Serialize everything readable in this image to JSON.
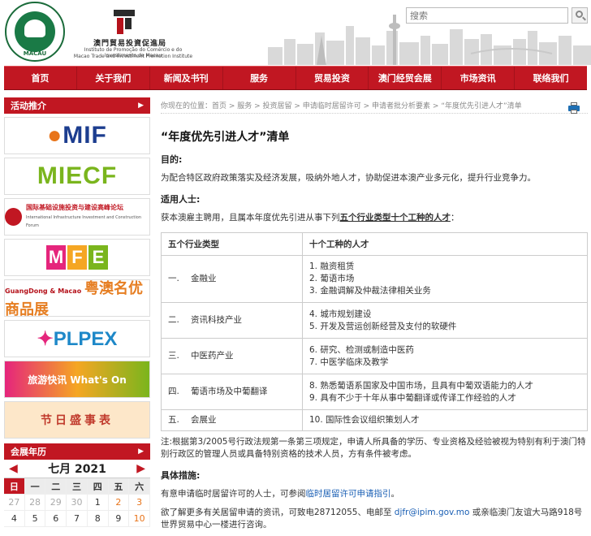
{
  "search": {
    "placeholder": "搜索"
  },
  "logo": {
    "macau_text": "MACAU",
    "org_cn": "澳門貿易投資促進局",
    "org_pt": "Instituto de Promoção do Comércio e do Investimento de Macau",
    "org_en": "Macao Trade and Investment Promotion Institute"
  },
  "nav": {
    "items": [
      "首页",
      "关于我们",
      "新闻及书刊",
      "服务",
      "贸易投资",
      "澳门经贸会展",
      "市场资讯",
      "联络我们"
    ]
  },
  "sidebar": {
    "activities_title": "活动推介",
    "banners": {
      "mif": "MIF",
      "miecf": "MIECF",
      "iif_cn": "国际基础设施投资与建设高峰论坛",
      "iif_en": "International Infrastructure Investment and Construction Forum",
      "mfe": [
        "M",
        "F",
        "E"
      ],
      "gd_en": "GuangDong & Macao",
      "gd_cn": "粤澳名优商品展",
      "plpex": "PLPEX",
      "tour": "旅游快讯 What's On",
      "fest": "节日盛事表"
    },
    "calendar_title": "会展年历",
    "calendar": {
      "month": "七月 2021",
      "weekdays": [
        "日",
        "一",
        "二",
        "三",
        "四",
        "五",
        "六"
      ],
      "rows": [
        [
          "27",
          "28",
          "29",
          "30",
          "1",
          "2",
          "3"
        ],
        [
          "4",
          "5",
          "6",
          "7",
          "8",
          "9",
          "10"
        ]
      ]
    }
  },
  "breadcrumb": "你现在的位置：首页 > 服务 > 投资居留 > 申请临时居留许可 > 申请者批分析要素 > “年度优先引进人才”清单",
  "page_title": "“年度优先引进人才”清单",
  "purpose": {
    "label": "目的:",
    "text": "为配合特区政府政策落实及经济发展，吸纳外地人才，协助促进本澳产业多元化，提升行业竞争力。"
  },
  "target": {
    "label": "适用人士:",
    "text_before": "获本澳雇主聘用，且属本年度优先引进从事下列",
    "text_underlined": "五个行业类型十个工种的人才",
    "text_after": "："
  },
  "table": {
    "headers": [
      "五个行业类型",
      "十个工种的人才"
    ],
    "rows": [
      {
        "num": "一.",
        "category": "金融业",
        "jobs": [
          "1. 融资租赁",
          "2. 葡语市场",
          "3. 金融调解及仲裁法律相关业务"
        ]
      },
      {
        "num": "二.",
        "category": "资讯科技产业",
        "jobs": [
          "4. 城市规划建设",
          "5. 开发及营运创新经营及支付的软硬件"
        ]
      },
      {
        "num": "三.",
        "category": "中医药产业",
        "jobs": [
          "6. 研究、检测或制造中医药",
          "7. 中医学临床及教学"
        ]
      },
      {
        "num": "四.",
        "category": "葡语市场及中葡翻译",
        "jobs": [
          "8. 熟悉葡语系国家及中国市场，且具有中葡双语能力的人才",
          "9. 具有不少于十年从事中葡翻译或传译工作经验的人才"
        ]
      },
      {
        "num": "五.",
        "category": "会展业",
        "jobs": [
          "10. 国际性会议组织策划人才"
        ]
      }
    ]
  },
  "note": "注:根据第3/2005号行政法规第一条第三项规定，申请人所具备的学历、专业资格及经验被视为特别有利于澳门特别行政区的管理人员或具备特别资格的技术人员，方有条件被考虑。",
  "measures": {
    "label": "具体措施:",
    "text_before": "有意申请临时居留许可的人士，可参阅",
    "link": "临时居留许可申请指引",
    "text_after": "。"
  },
  "contact": {
    "text_before": "欲了解更多有关居留申请的资讯，可致电28712055、电邮至 ",
    "email": "djfr@ipim.gov.mo",
    "text_after": " 或亲临澳门友谊大马路918号世界贸易中心一楼进行咨询。"
  },
  "colors": {
    "brand_red": "#c11722",
    "link_blue": "#1a5fb4"
  }
}
